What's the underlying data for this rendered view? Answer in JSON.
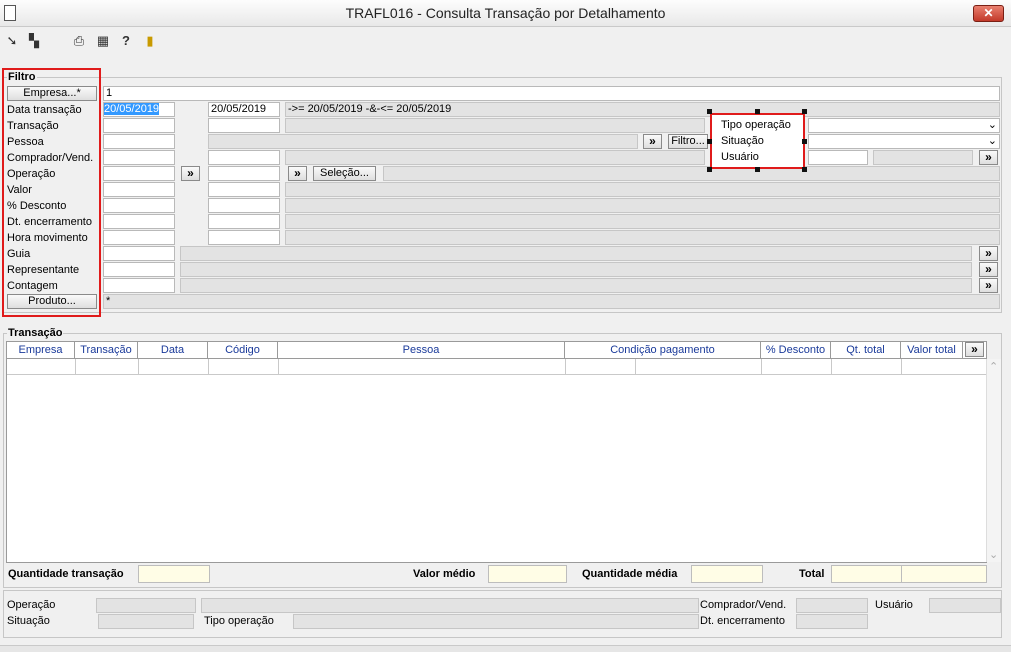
{
  "window": {
    "title": "TRAFL016 - Consulta Transação por Detalhamento",
    "close_label": "✕"
  },
  "toolbar": {
    "icons": [
      "arrow-icon",
      "layers-icon",
      "print-icon",
      "grid-icon",
      "help-icon",
      "exit-icon"
    ]
  },
  "filtro": {
    "title": "Filtro",
    "empresa_button": "Empresa...*",
    "empresa_value": "1",
    "data_transacao_label": "Data transação",
    "data_from": "20/05/2019",
    "data_to": "20/05/2019",
    "data_summary": "->= 20/05/2019 -&-<= 20/05/2019",
    "rows": [
      "Transação",
      "Pessoa",
      "Comprador/Vend.",
      "Operação",
      "Valor",
      "% Desconto",
      "Dt. encerramento",
      "Hora movimento",
      "Guia",
      "Representante",
      "Contagem"
    ],
    "produto_button": "Produto...",
    "produto_value": "*",
    "filtro_button": "Filtro...",
    "selecao_button": "Seleção...",
    "expand_glyph": "»"
  },
  "dropdown": {
    "items": [
      "Tipo operação",
      "Situação",
      "Usuário"
    ]
  },
  "transacao": {
    "title": "Transação",
    "columns": [
      "Empresa",
      "Transação",
      "Data",
      "Código",
      "Pessoa",
      "Condição pagamento",
      "% Desconto",
      "Qt. total",
      "Valor total"
    ],
    "expand_glyph": "»"
  },
  "totals": {
    "quantidade_transacao": "Quantidade transação",
    "valor_medio": "Valor médio",
    "quantidade_media": "Quantidade média",
    "total": "Total"
  },
  "footer": {
    "operacao": "Operação",
    "situacao": "Situação",
    "tipo_operacao": "Tipo operação",
    "comprador": "Comprador/Vend.",
    "dt_encerramento": "Dt. encerramento",
    "usuario": "Usuário"
  },
  "colors": {
    "highlight_red": "#e01b1b",
    "header_blue": "#1a3a9a",
    "summary_yellow": "#fffde6"
  }
}
